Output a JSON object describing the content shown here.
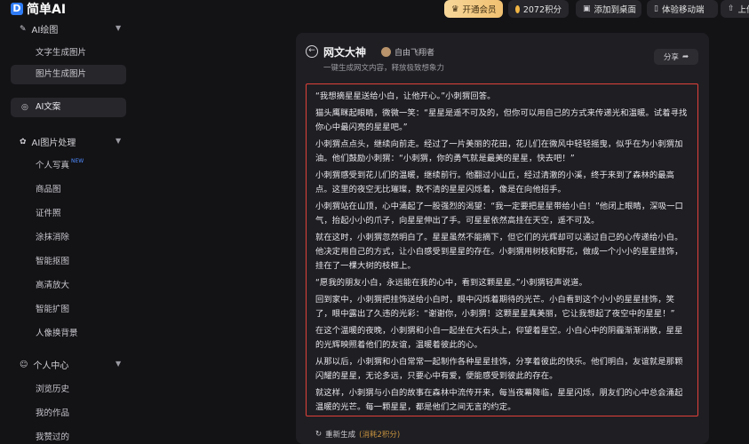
{
  "app": {
    "logo_text": "简单AI",
    "logo_mark": "D"
  },
  "topbar": {
    "vip_label": "开通会员",
    "points_label": "2072积分",
    "desktop_label": "添加到桌面",
    "mobile_label": "体验移动端",
    "upload_label": "上传"
  },
  "sidebar": {
    "groups": [
      {
        "label": "AI绘图",
        "icon": "paint-icon"
      },
      {
        "label": "AI图片处理",
        "icon": "palette-icon"
      },
      {
        "label": "个人中心",
        "icon": "user-icon"
      }
    ],
    "draw_items": [
      "文字生成图片",
      "图片生成图片"
    ],
    "ai_text_label": "AI文案",
    "image_items": [
      "个人写真",
      "商品图",
      "证件照",
      "涂抹消除",
      "智能抠图",
      "高清放大",
      "智能扩图",
      "人像换背景"
    ],
    "new_tag": "NEW",
    "user_items": [
      "浏览历史",
      "我的作品",
      "我赞过的"
    ]
  },
  "panel": {
    "title": "网文大神",
    "author": "自由飞翔者",
    "subtitle": "一键生成网文内容，释放极致想象力",
    "share_label": "分享",
    "paragraphs": [
      "“我想摘星星送给小白，让他开心。”小刺猬回答。",
      "猫头鹰眯起眼睛，微微一笑：“星星是遥不可及的，但你可以用自己的方式来传递光和温暖。试着寻找你心中最闪亮的星星吧。”",
      "小刺猬点点头，继续向前走。经过了一片美丽的花田，花儿们在微风中轻轻摇曳，似乎在为小刺猬加油。他们鼓励小刺猬：“小刺猬，你的勇气就是最美的星星，快去吧！”",
      "小刺猬感受到花儿们的温暖，继续前行。他翻过小山丘，经过清澈的小溪，终于来到了森林的最高点。这里的夜空无比璀璨，数不清的星星闪烁着，像是在向他招手。",
      "小刺猬站在山顶，心中涌起了一股强烈的渴望：“我一定要把星星带给小白！”他闭上眼睛，深吸一口气，抬起小小的爪子，向星星伸出了手。可星星依然高挂在天空，遥不可及。",
      "就在这时，小刺猬忽然明白了。星星虽然不能摘下，但它们的光辉却可以通过自己的心传递给小白。他决定用自己的方式，让小白感受到星星的存在。小刺猬用树枝和野花，做成一个小小的星星挂饰，挂在了一棵大树的枝桠上。",
      "“愿我的朋友小白，永远能在我的心中，看到这颗星星。”小刺猬轻声说道。",
      "回到家中，小刺猬把挂饰送给小白时，眼中闪烁着期待的光芒。小白看到这个小小的星星挂饰，笑了，眼中露出了久违的光彩：“谢谢你，小刺猬！这颗星星真美丽，它让我想起了夜空中的星星！”",
      "在这个温暖的夜晚，小刺猬和小白一起坐在大石头上，仰望着星空。小白心中的阴霾渐渐消散，星星的光辉映照着他们的友谊，温暖着彼此的心。",
      "从那以后，小刺猬和小白常常一起制作各种星星挂饰，分享着彼此的快乐。他们明白，友谊就是那颗闪耀的星星，无论多远，只要心中有爱，便能感受到彼此的存在。",
      "就这样，小刺猬与小白的故事在森林中流传开来，每当夜幕降临，星星闪烁，朋友们的心中总会涌起温暖的光芒。每一颗星星，都是他们之间无言的约定。"
    ],
    "regen_label": "重新生成",
    "regen_cost": "(消耗2积分)"
  },
  "colors": {
    "accent": "#e0403a",
    "brand": "#2f7cf6",
    "vip": "#f0c070"
  }
}
